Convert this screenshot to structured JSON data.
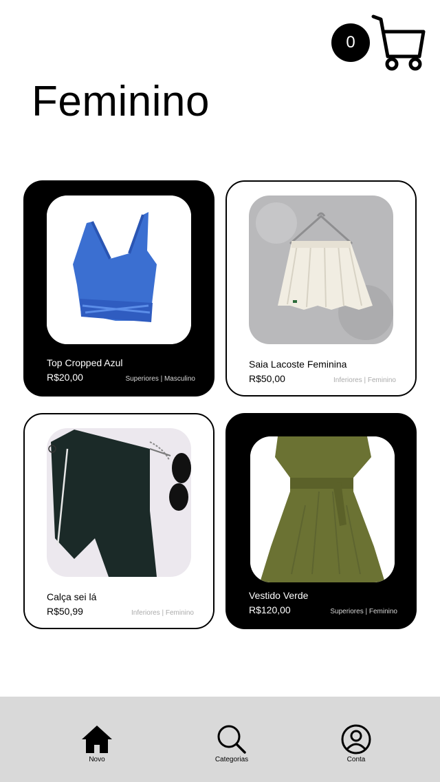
{
  "cart": {
    "count": "0",
    "icon": "cart-icon"
  },
  "page": {
    "title": "Feminino"
  },
  "products": [
    {
      "name": "Top Cropped Azul",
      "price": "R$20,00",
      "tags": "Superiores | Masculino",
      "theme": "dark",
      "image": "blue-cropped-top"
    },
    {
      "name": "Saia Lacoste Feminina",
      "price": "R$50,00",
      "tags": "Inferiores | Feminino",
      "theme": "light",
      "image": "white-pleated-skirt"
    },
    {
      "name": "Calça sei lá",
      "price": "R$50,99",
      "tags": "Inferiores | Feminino",
      "theme": "light",
      "image": "dark-green-pants"
    },
    {
      "name": "Vestido Verde",
      "price": "R$120,00",
      "tags": "Superiores | Feminino",
      "theme": "dark",
      "image": "olive-green-dress"
    }
  ],
  "nav": {
    "items": [
      {
        "label": "Novo",
        "icon": "home-icon"
      },
      {
        "label": "Categorias",
        "icon": "search-icon"
      },
      {
        "label": "Conta",
        "icon": "user-icon"
      }
    ],
    "background": "#d9d9d9"
  }
}
